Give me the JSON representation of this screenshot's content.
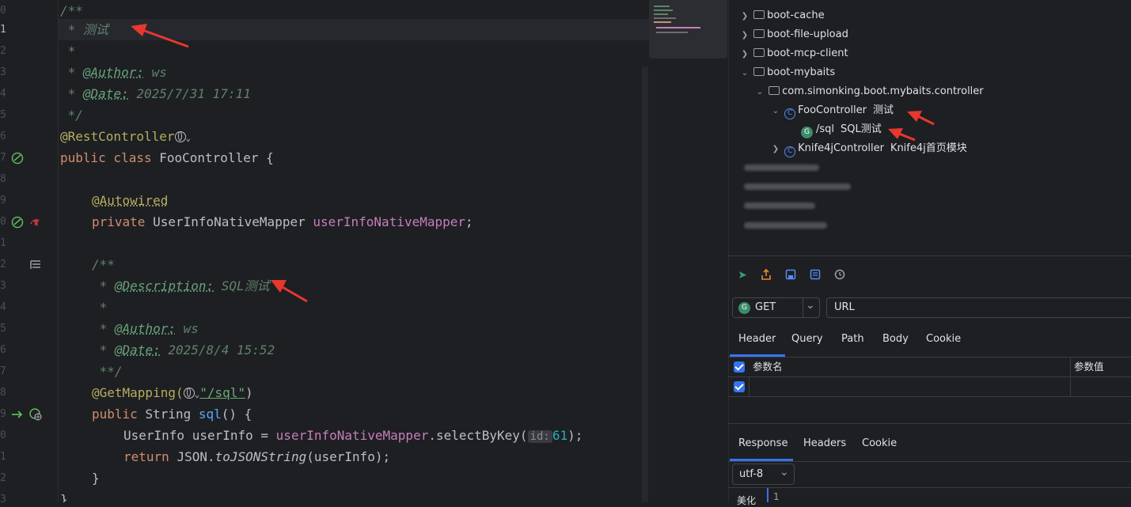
{
  "editor": {
    "line_numbers": [
      "0",
      "1",
      "2",
      "3",
      "4",
      "5",
      "6",
      "7",
      "8",
      "9",
      "0",
      "1",
      "2",
      "3",
      "4",
      "5",
      "6",
      "7",
      "8",
      "9",
      "0",
      "1",
      "2",
      "3"
    ],
    "code": {
      "l0": "/**",
      "l1_star": " * ",
      "l1_text": "测试",
      "l2": " *",
      "l3_star": " * ",
      "l3_tag": "@Author:",
      "l3_val": " ws",
      "l4_star": " * ",
      "l4_tag": "@Date:",
      "l4_val": " 2025/7/31 17:11",
      "l5": " */",
      "l6_ann": "@RestController",
      "l7_kw": "public class ",
      "l7_name": "FooController ",
      "l7_brace": "{",
      "l9_ann": "@Autowired",
      "l10_kw": "private ",
      "l10_type": "UserInfoNativeMapper ",
      "l10_field": "userInfoNativeMapper",
      "l10_end": ";",
      "l12": "/**",
      "l13_star": " * ",
      "l13_tag": "@Description:",
      "l13_val": " SQL测试",
      "l14": " *",
      "l15_star": " * ",
      "l15_tag": "@Author:",
      "l15_val": " ws",
      "l16_star": " * ",
      "l16_tag": "@Date:",
      "l16_val": " 2025/8/4 15:52",
      "l17": " **/",
      "l18_ann": "@GetMapping(",
      "l18_str": "\"/sql\"",
      "l18_end": ")",
      "l19_kw": "public ",
      "l19_type": "String ",
      "l19_fn": "sql",
      "l19_end": "() {",
      "l20_type": "UserInfo ",
      "l20_var": "userInfo = ",
      "l20_field": "userInfoNativeMapper",
      "l20_call": ".selectByKey(",
      "l20_hint": "id:",
      "l20_num": "61",
      "l20_end": ");",
      "l21_kw": "return ",
      "l21_obj": "JSON.",
      "l21_fn": "toJSONString",
      "l21_end": "(userInfo);",
      "l22": "}",
      "l23": "}"
    }
  },
  "tree": {
    "items": [
      {
        "label": "boot-cache"
      },
      {
        "label": "boot-file-upload"
      },
      {
        "label": "boot-mcp-client"
      },
      {
        "label": "boot-mybaits"
      },
      {
        "label": "com.simonking.boot.mybaits.controller"
      },
      {
        "label": "FooController",
        "desc": "测试"
      },
      {
        "label": "/sql",
        "desc": "SQL测试"
      },
      {
        "label": "Knife4jController",
        "desc": "Knife4j首页模块"
      }
    ]
  },
  "request": {
    "method": "GET",
    "url_placeholder": "URL",
    "tabs": [
      "Header",
      "Query",
      "Path",
      "Body",
      "Cookie"
    ],
    "table_headers": [
      "参数名",
      "参数值"
    ]
  },
  "response": {
    "tabs": [
      "Response",
      "Headers",
      "Cookie"
    ],
    "encoding": "utf-8",
    "line_no": "1",
    "side_label": "美化"
  },
  "colors": {
    "accent": "#3574f0",
    "arrow": "#e8372e"
  }
}
